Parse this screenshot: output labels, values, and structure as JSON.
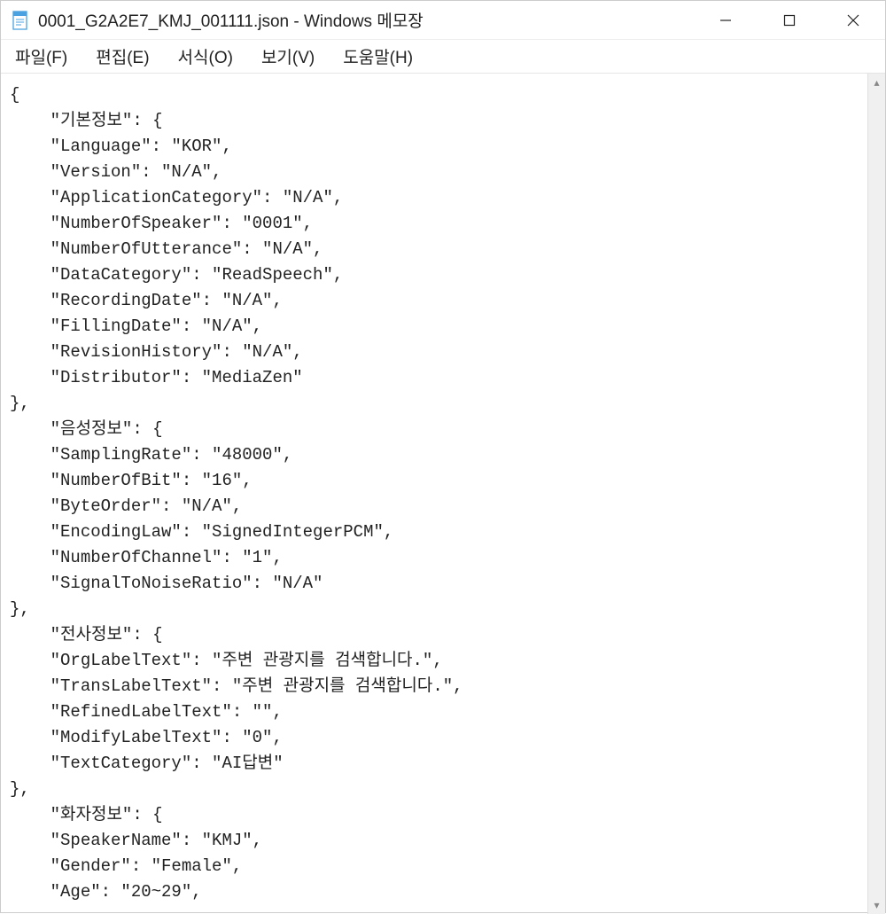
{
  "titlebar": {
    "title": "0001_G2A2E7_KMJ_001111.json - Windows 메모장"
  },
  "menubar": {
    "file": "파일(F)",
    "edit": "편집(E)",
    "format": "서식(O)",
    "view": "보기(V)",
    "help": "도움말(H)"
  },
  "content": {
    "open_brace": "{",
    "sec1_header": "    \"기본정보\": {",
    "sec1_k1": "    \"Language\": \"KOR\",",
    "sec1_k2": "    \"Version\": \"N/A\",",
    "sec1_k3": "    \"ApplicationCategory\": \"N/A\",",
    "sec1_k4": "    \"NumberOfSpeaker\": \"0001\",",
    "sec1_k5": "    \"NumberOfUtterance\": \"N/A\",",
    "sec1_k6": "    \"DataCategory\": \"ReadSpeech\",",
    "sec1_k7": "    \"RecordingDate\": \"N/A\",",
    "sec1_k8": "    \"FillingDate\": \"N/A\",",
    "sec1_k9": "    \"RevisionHistory\": \"N/A\",",
    "sec1_k10": "    \"Distributor\": \"MediaZen\"",
    "sec1_close": "},",
    "sec2_header": "    \"음성정보\": {",
    "sec2_k1": "    \"SamplingRate\": \"48000\",",
    "sec2_k2": "    \"NumberOfBit\": \"16\",",
    "sec2_k3": "    \"ByteOrder\": \"N/A\",",
    "sec2_k4": "    \"EncodingLaw\": \"SignedIntegerPCM\",",
    "sec2_k5": "    \"NumberOfChannel\": \"1\",",
    "sec2_k6": "    \"SignalToNoiseRatio\": \"N/A\"",
    "sec2_close": "},",
    "sec3_header": "    \"전사정보\": {",
    "sec3_k1": "    \"OrgLabelText\": \"주변 관광지를 검색합니다.\",",
    "sec3_k2": "    \"TransLabelText\": \"주변 관광지를 검색합니다.\",",
    "sec3_k3": "    \"RefinedLabelText\": \"\",",
    "sec3_k4": "    \"ModifyLabelText\": \"0\",",
    "sec3_k5": "    \"TextCategory\": \"AI답변\"",
    "sec3_close": "},",
    "sec4_header": "    \"화자정보\": {",
    "sec4_k1": "    \"SpeakerName\": \"KMJ\",",
    "sec4_k2": "    \"Gender\": \"Female\",",
    "sec4_k3": "    \"Age\": \"20~29\","
  }
}
